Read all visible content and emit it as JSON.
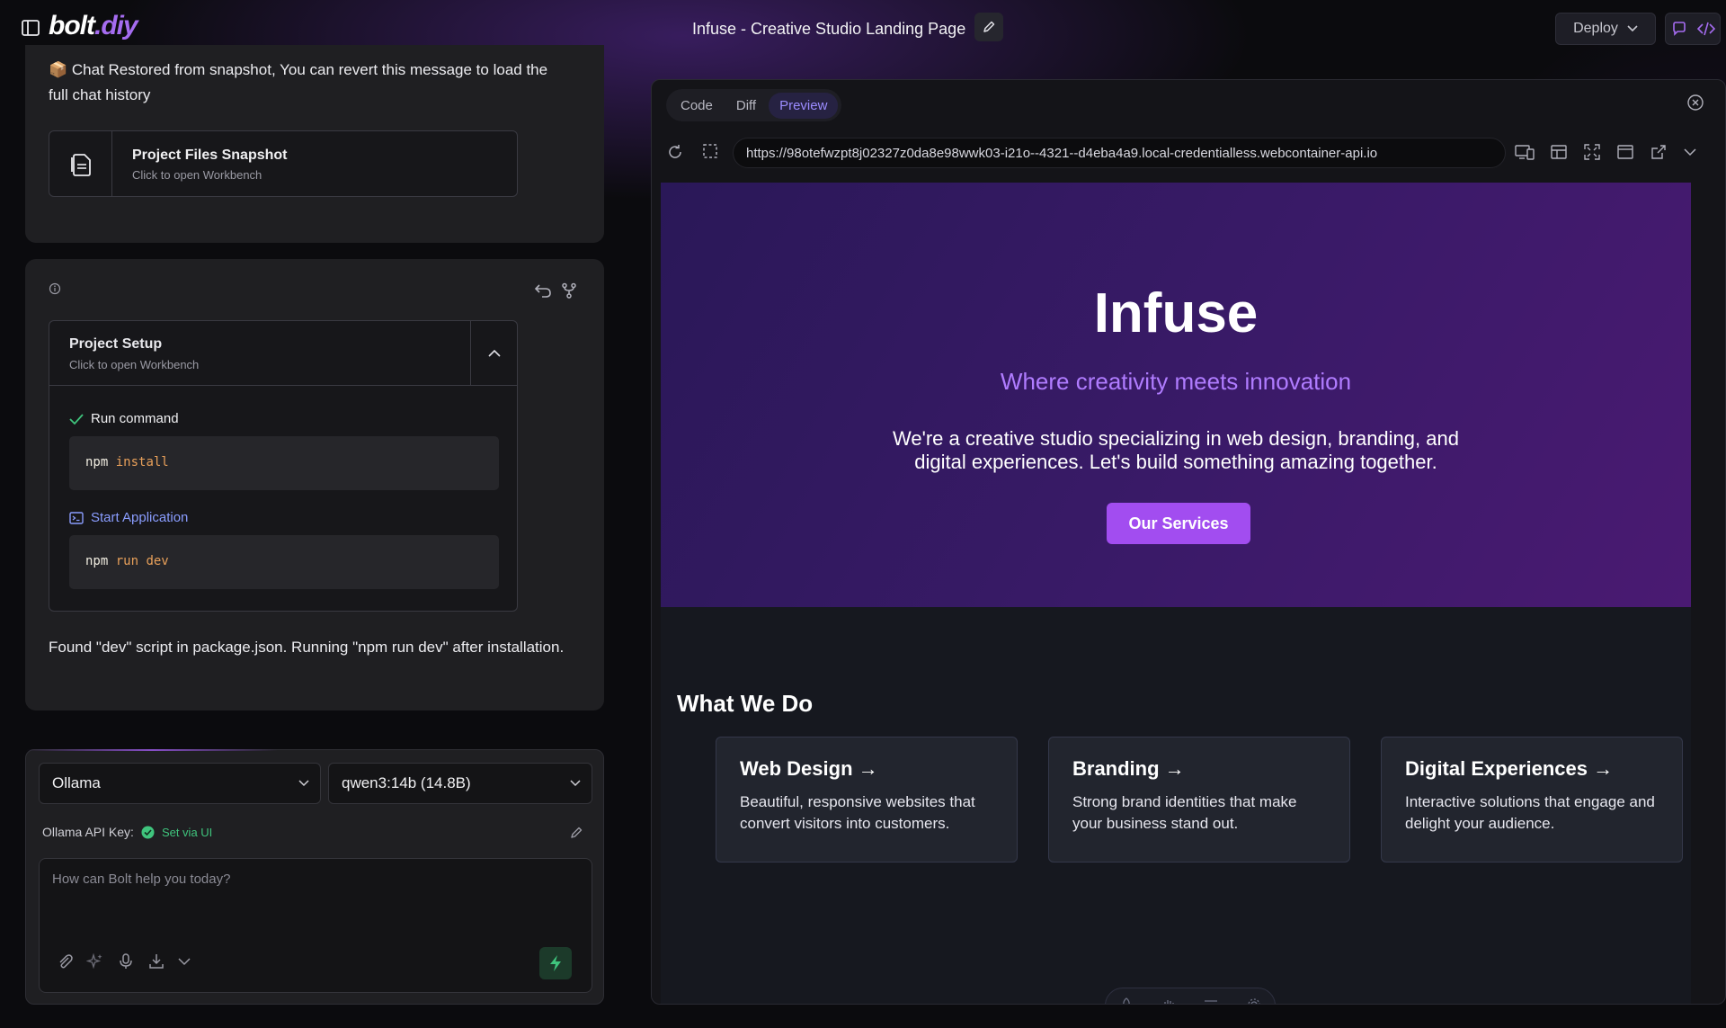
{
  "header": {
    "logo_main": "bolt",
    "logo_accent": ".diy",
    "project_title": "Infuse - Creative Studio Landing Page",
    "deploy_label": "Deploy"
  },
  "chat": {
    "restored_message": "📦 Chat Restored from snapshot, You can revert this message to load the full chat history",
    "snapshot_card": {
      "title": "Project Files Snapshot",
      "subtitle": "Click to open Workbench"
    },
    "setup_card": {
      "title": "Project Setup",
      "subtitle": "Click to open Workbench",
      "steps": [
        {
          "label": "Run command",
          "cmd": "npm",
          "args": " install"
        },
        {
          "label": "Start Application",
          "cmd": "npm",
          "args": " run dev"
        }
      ]
    },
    "found_message": "Found \"dev\" script in package.json. Running \"npm run dev\" after installation."
  },
  "input": {
    "provider": "Ollama",
    "model": "qwen3:14b (14.8B)",
    "api_key_label": "Ollama API Key:",
    "api_key_status": "Set via UI",
    "prompt_placeholder": "How can Bolt help you today?"
  },
  "workbench": {
    "tabs": [
      "Code",
      "Diff",
      "Preview"
    ],
    "active_tab": "Preview",
    "url": "https://98otefwzpt8j02327z0da8e98wwk03-i21o--4321--d4eba4a9.local-credentialless.webcontainer-api.io"
  },
  "site": {
    "hero_title": "Infuse",
    "hero_tagline": "Where creativity meets innovation",
    "hero_description": "We're a creative studio specializing in web design, branding, and digital experiences. Let's build something amazing together.",
    "cta_label": "Our Services",
    "section_title": "What We Do",
    "services": [
      {
        "title": "Web Design →",
        "description": "Beautiful, responsive websites that convert visitors into customers."
      },
      {
        "title": "Branding →",
        "description": "Strong brand identities that make your business stand out."
      },
      {
        "title": "Digital Experiences →",
        "description": "Interactive solutions that engage and delight your audience."
      }
    ]
  },
  "colors": {
    "accent": "#a24df0",
    "tagline": "#b07cff",
    "active_tab_text": "#9b8cff",
    "success": "#3fc47d",
    "code_arg": "#e8a05a"
  }
}
